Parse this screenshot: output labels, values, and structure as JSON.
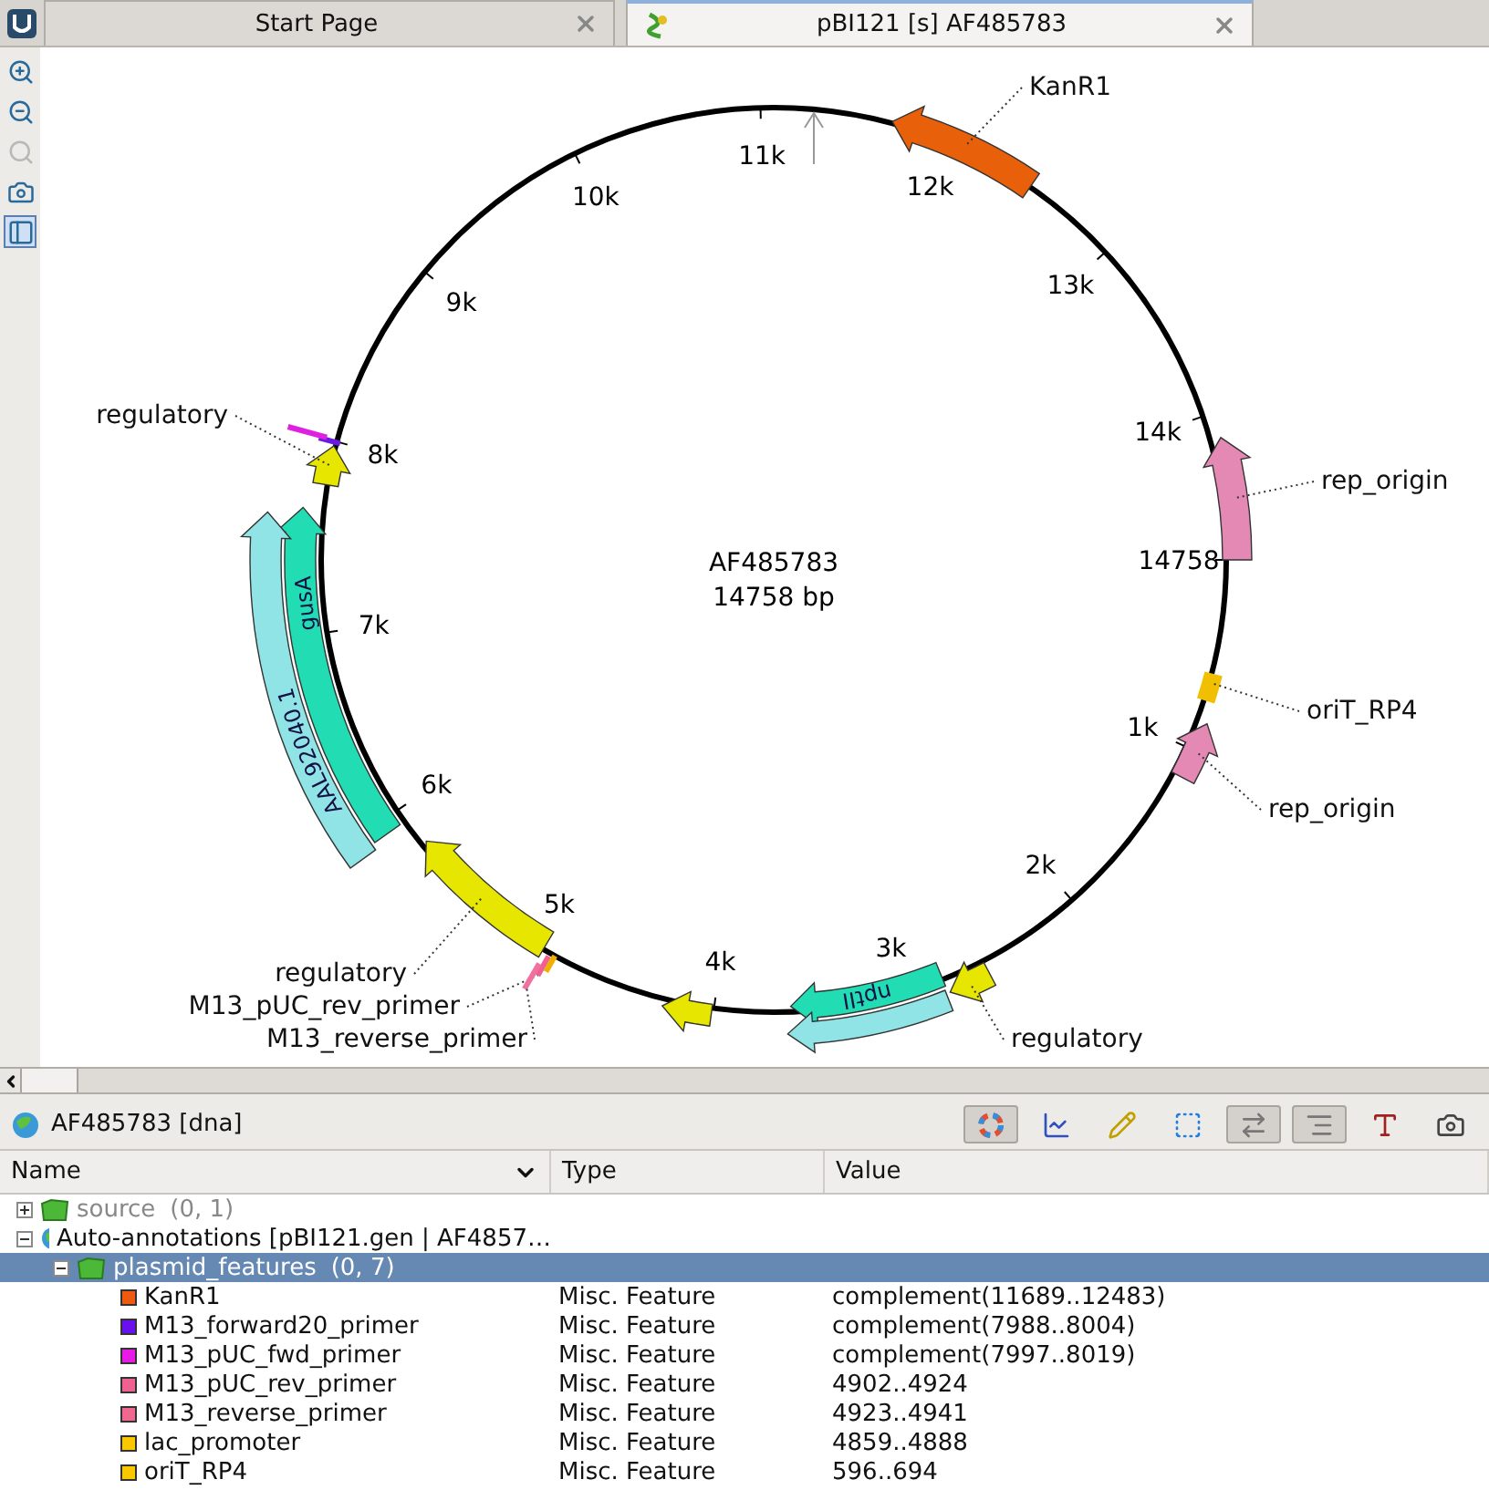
{
  "tabs": [
    {
      "label": "Start Page",
      "selected": false
    },
    {
      "label": "pBI121 [s] AF485783",
      "selected": true
    }
  ],
  "side_tools": [
    {
      "kind": "zoom-in",
      "disabled": false,
      "pressed": false
    },
    {
      "kind": "zoom-out",
      "disabled": false,
      "pressed": false
    },
    {
      "kind": "zoom-fit",
      "disabled": true,
      "pressed": false
    },
    {
      "kind": "camera",
      "disabled": false,
      "pressed": false
    },
    {
      "kind": "panel",
      "disabled": false,
      "pressed": true
    }
  ],
  "map": {
    "name": "AF485783",
    "length": "14758 bp",
    "ticks": [
      "1k",
      "2k",
      "3k",
      "4k",
      "5k",
      "6k",
      "7k",
      "8k",
      "9k",
      "10k",
      "11k",
      "12k",
      "13k",
      "14k",
      "14758"
    ],
    "features": [
      {
        "kind": "arrow",
        "label": "KanR1",
        "color": "#e8600a"
      },
      {
        "kind": "arrow",
        "label": "rep_origin",
        "color": "#e488b4"
      },
      {
        "kind": "box",
        "label": "oriT_RP4",
        "color": "#f0c000"
      },
      {
        "kind": "arrow",
        "label": "rep_origin",
        "color": "#e488b4"
      },
      {
        "kind": "arrow",
        "label": "regulatory",
        "color": "#e6e600"
      },
      {
        "kind": "arrow",
        "inner_label": "nptII",
        "color": "#22dcb4"
      },
      {
        "kind": "arrow",
        "color": "#90e4e6"
      },
      {
        "kind": "arrow",
        "color": "#e6e600"
      },
      {
        "kind": "arrow",
        "label": "regulatory",
        "color": "#e6e600"
      },
      {
        "kind": "mark",
        "label": "M13_pUC_rev_primer",
        "color": "#f06090"
      },
      {
        "kind": "mark",
        "label": "M13_reverse_primer",
        "color": "#f070a0"
      },
      {
        "kind": "mark",
        "color": "#f0b000"
      },
      {
        "kind": "arrow",
        "inner_label": "gusA",
        "color": "#22dcb4"
      },
      {
        "kind": "arrow",
        "inner_label": "AAL92040.1",
        "color": "#90e4e6"
      },
      {
        "kind": "arrow",
        "label": "regulatory",
        "color": "#e6e600"
      },
      {
        "kind": "mark",
        "color": "#6a1ae0"
      },
      {
        "kind": "mark",
        "color": "#e020e0"
      }
    ]
  },
  "panel": {
    "title": "AF485783 [dna]",
    "tools": [
      {
        "kind": "circular",
        "pressed": true
      },
      {
        "kind": "graph",
        "pressed": false
      },
      {
        "kind": "annotate",
        "pressed": false
      },
      {
        "kind": "select",
        "pressed": false
      },
      {
        "kind": "complement",
        "pressed": true
      },
      {
        "kind": "translate",
        "pressed": true
      },
      {
        "kind": "font",
        "pressed": false
      },
      {
        "kind": "camera",
        "pressed": false
      }
    ]
  },
  "table": {
    "columns": [
      "Name",
      "Type",
      "Value"
    ],
    "rows": [
      {
        "name": "source",
        "count": "(0, 1)",
        "expanded": false,
        "dimmed": true,
        "selected": false,
        "kind": "group",
        "children": []
      },
      {
        "name": "Auto-annotations [pBI121.gen | AF4857…",
        "expanded": true,
        "dimmed": false,
        "selected": false,
        "kind": "annotation",
        "children": [
          {
            "name": "plasmid_features",
            "count": "(0, 7)",
            "expanded": true,
            "dimmed": false,
            "selected": true,
            "kind": "group",
            "children": [
              {
                "name": "KanR1",
                "color": "#f05a10",
                "type": "Misc. Feature",
                "value": "complement(11689..12483)",
                "selected": false
              },
              {
                "name": "M13_forward20_primer",
                "color": "#6a10f0",
                "type": "Misc. Feature",
                "value": "complement(7988..8004)",
                "selected": false
              },
              {
                "name": "M13_pUC_fwd_primer",
                "color": "#e81ae8",
                "type": "Misc. Feature",
                "value": "complement(7997..8019)",
                "selected": false
              },
              {
                "name": "M13_pUC_rev_primer",
                "color": "#f06090",
                "type": "Misc. Feature",
                "value": "4902..4924",
                "selected": false
              },
              {
                "name": "M13_reverse_primer",
                "color": "#f06890",
                "type": "Misc. Feature",
                "value": "4923..4941",
                "selected": false
              },
              {
                "name": "lac_promoter",
                "color": "#f8c800",
                "type": "Misc. Feature",
                "value": "4859..4888",
                "selected": false
              },
              {
                "name": "oriT_RP4",
                "color": "#f8c800",
                "type": "Misc. Feature",
                "value": "596..694",
                "selected": false
              }
            ]
          }
        ]
      }
    ]
  }
}
